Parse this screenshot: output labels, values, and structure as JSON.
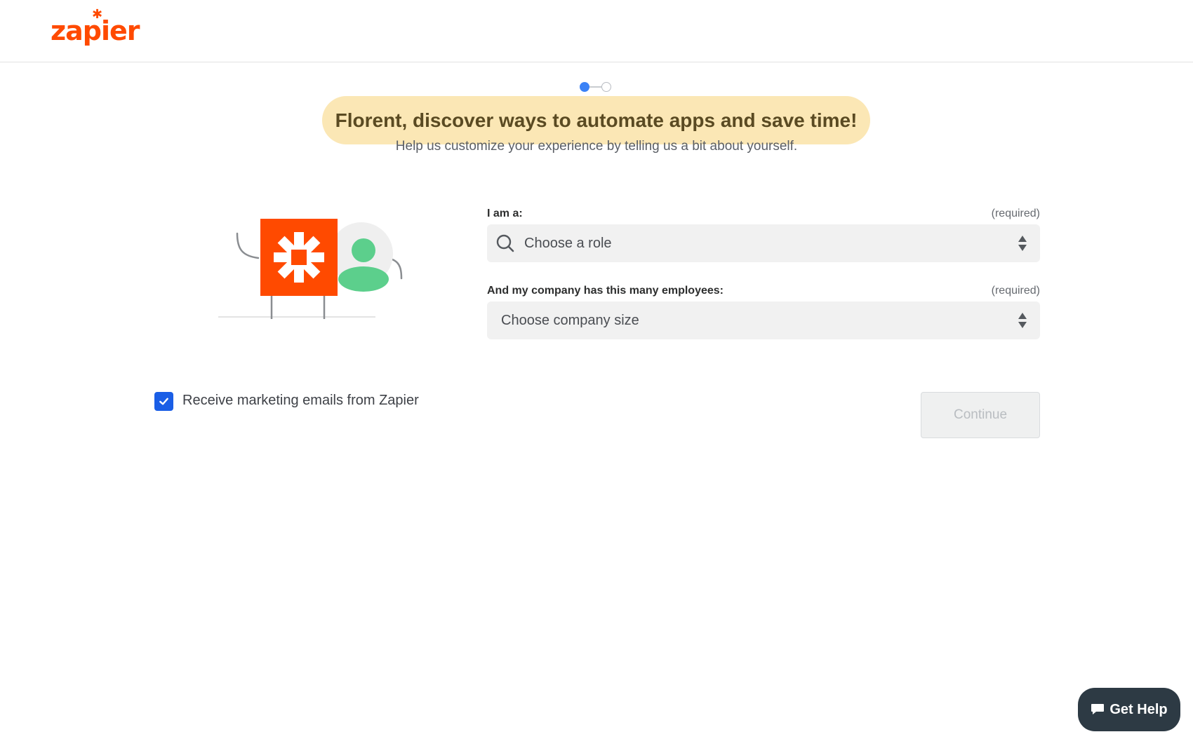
{
  "brand": {
    "logo_text": "zapier"
  },
  "stepper": {
    "total_steps": 2,
    "current_step": 1
  },
  "hero": {
    "headline": "Florent, discover ways to automate apps and save time!",
    "subtitle": "Help us customize your experience by telling us a bit about yourself."
  },
  "form": {
    "role": {
      "label": "I am a:",
      "required": "(required)",
      "placeholder": "Choose a role"
    },
    "company": {
      "label": "And my company has this many employees:",
      "required": "(required)",
      "placeholder": "Choose company size"
    },
    "marketing": {
      "label": "Receive marketing emails from Zapier",
      "checked": true
    },
    "continue_label": "Continue"
  },
  "help": {
    "label": "Get Help"
  },
  "colors": {
    "brand_orange": "#ff4a00",
    "headline_bg": "#fbe7b5",
    "checkbox_blue": "#1a5ee6",
    "help_bg": "#2d3a44"
  }
}
